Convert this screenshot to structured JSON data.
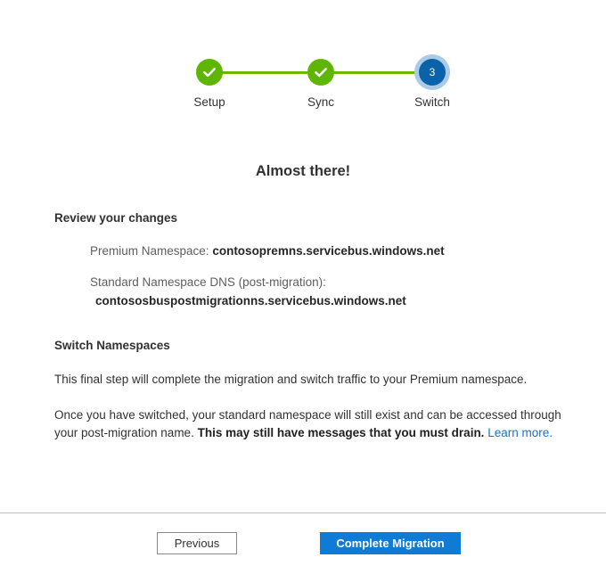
{
  "wizard": {
    "steps": [
      {
        "label": "Setup",
        "state": "done",
        "indicator": "check"
      },
      {
        "label": "Sync",
        "state": "done",
        "indicator": "check"
      },
      {
        "label": "Switch",
        "state": "current",
        "indicator": "3"
      }
    ]
  },
  "main": {
    "title": "Almost there!",
    "review_heading": "Review your changes",
    "namespaces": [
      {
        "label": "Premium Namespace:",
        "value": "contosopremns.servicebus.windows.net",
        "stacked": false
      },
      {
        "label": "Standard Namespace DNS (post-migration):",
        "value": "contososbuspostmigrationns.servicebus.windows.net",
        "stacked": true
      }
    ],
    "switch_heading": "Switch Namespaces",
    "paragraph_one": "This final step will complete the migration and switch traffic to your Premium namespace.",
    "paragraph_two_lead": "Once you have switched, your standard namespace will still exist and can be accessed through your post-migration name. ",
    "paragraph_two_bold": "This may still have messages that you must drain.",
    "paragraph_two_link": "Learn more."
  },
  "footer": {
    "previous_label": "Previous",
    "primary_label": "Complete Migration"
  },
  "colors": {
    "step_done": "#5fb503",
    "step_current": "#0a63a8",
    "step_current_halo": "#a9cbe8",
    "connector": "#6bb700",
    "link": "#1a73c8",
    "primary_button": "#0f7bd4",
    "divider": "#bdbdbd",
    "label_gray": "#605e5c",
    "text": "#323130"
  }
}
